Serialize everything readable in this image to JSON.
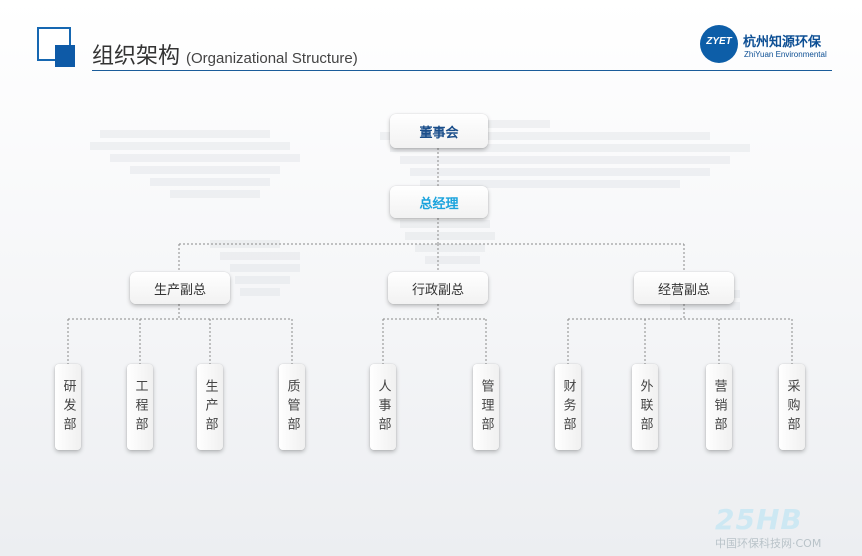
{
  "header": {
    "title": "组织架构",
    "subtitle": "(Organizational Structure)",
    "logo_mark": "ZYET",
    "logo_name": "杭州知源环保",
    "logo_en": "ZhiYuan Environmental"
  },
  "org": {
    "top": "董事会",
    "gm": "总经理",
    "vps": [
      {
        "label": "生产副总",
        "depts": [
          "研发部",
          "工程部",
          "生产部",
          "质管部"
        ]
      },
      {
        "label": "行政副总",
        "depts": [
          "人事部",
          "管理部"
        ]
      },
      {
        "label": "经营副总",
        "depts": [
          "财务部",
          "外联部",
          "营销部",
          "采购部"
        ]
      }
    ]
  },
  "watermark": {
    "logo": "25HB",
    "text": "中国环保科技网·COM"
  },
  "colors": {
    "brand_blue": "#0e5aa7",
    "gm_text": "#1aa3dd",
    "top_text": "#1a4e8a"
  }
}
